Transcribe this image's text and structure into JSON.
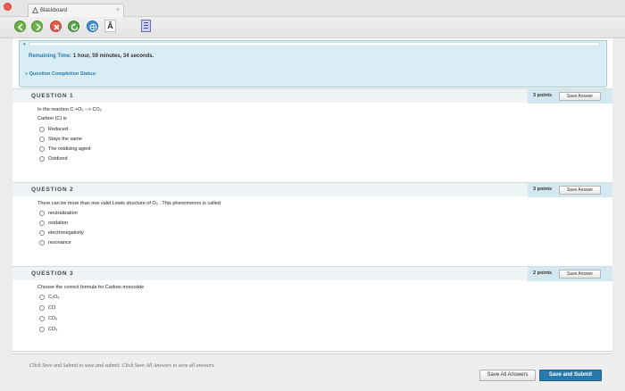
{
  "window": {
    "tab_title": "Blackboard",
    "tab_close": "×"
  },
  "toolbar": {
    "text_tool": "Ā"
  },
  "timer": {
    "collapse_glyph": "▾",
    "remaining_label": "Remaining Time:",
    "remaining_value": "1 hour, 59 minutes, 34 seconds.",
    "completion_status": "» Question Completion Status:"
  },
  "questions": [
    {
      "title": "QUESTION 1",
      "points": "3 points",
      "save_label": "Save Answer",
      "text": "In the reaction C +O₂ --> CO₂",
      "text2": "Carbon (C) is",
      "options": [
        "Reduced",
        "Stays the same",
        "The oxidizing agent",
        "Oxidized"
      ]
    },
    {
      "title": "QUESTION 2",
      "points": "3 points",
      "save_label": "Save Answer",
      "text": "There can be more than one valid Lewis structure of O₃ . This phenomenon is called",
      "text2": "",
      "options": [
        "neutralization",
        "oxidation",
        "electronegativity",
        "resonance"
      ]
    },
    {
      "title": "QUESTION 3",
      "points": "2 points",
      "save_label": "Save Answer",
      "text": "Choose the correct formula for Carbon monoxide",
      "text2": "",
      "options": [
        "C₂O₄",
        "CO",
        "CO₂",
        "CO₃"
      ]
    }
  ],
  "footer": {
    "hint": "Click Save and Submit to save and submit. Click Save All Answers to save all answers.",
    "save_all_label": "Save All Answers",
    "submit_label": "Save and Submit"
  },
  "colors": {
    "accent": "#2a79ad",
    "link": "#2a7bab",
    "timer_bg": "#d9eef4"
  }
}
